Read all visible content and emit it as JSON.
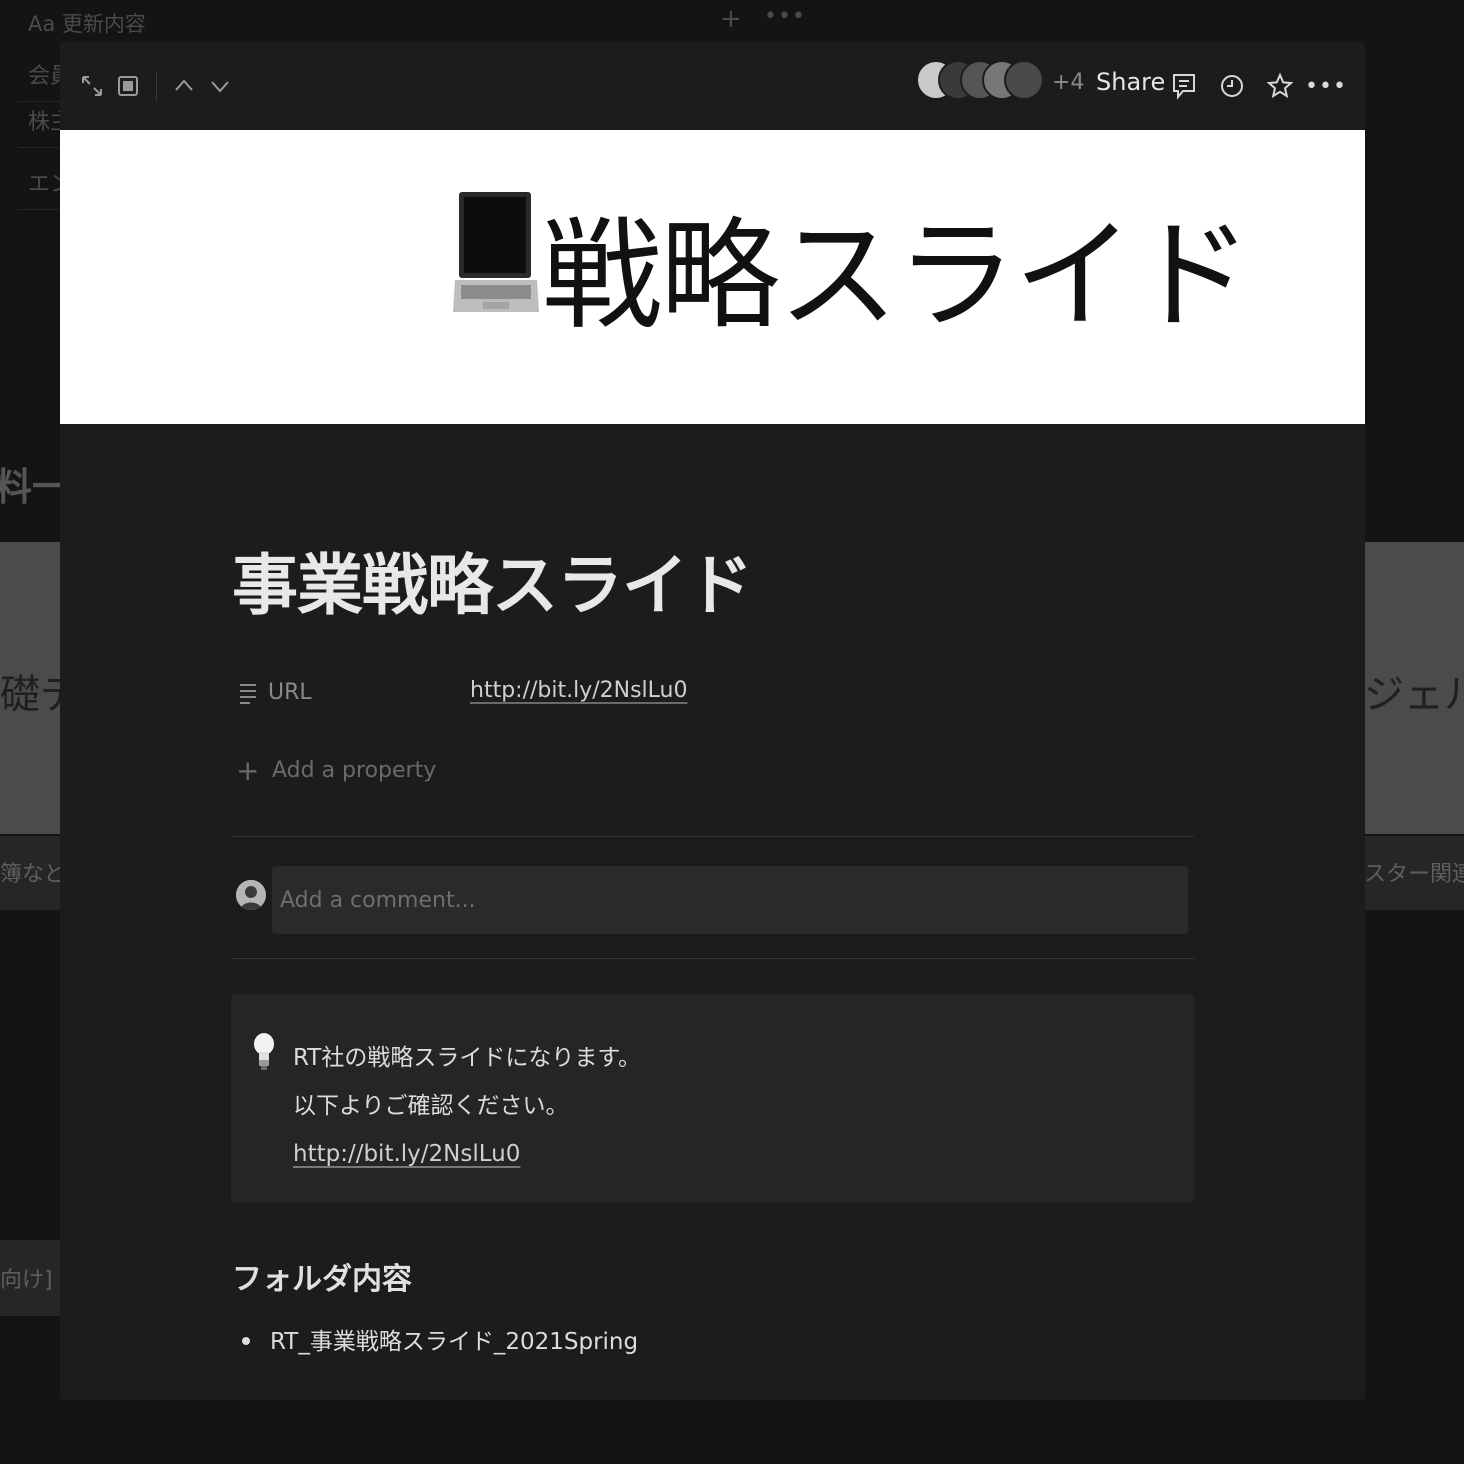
{
  "background": {
    "db_title": "Aa 更新内容",
    "db_plus": "+",
    "db_more": "•••",
    "rows": [
      "会員",
      "株主",
      "エン"
    ],
    "section_heading": "料一式",
    "card_left_title": "礎デ",
    "card_right_title": "ジェル",
    "caption_left": "簿など",
    "caption_right": "スター関連資",
    "caption_left_2": "向け]"
  },
  "topbar": {
    "expand_icon": "expand-icon",
    "peek_icon": "peek-mode-icon",
    "up_icon": "chevron-up-icon",
    "down_icon": "chevron-down-icon",
    "extra_avatars": "+4",
    "share_label": "Share",
    "comments_icon": "comments-icon",
    "updates_icon": "clock-icon",
    "favorite_icon": "star-icon",
    "more_label": "•••"
  },
  "cover": {
    "emoji": "laptop-icon",
    "title": "戦略スライド"
  },
  "page": {
    "title": "事業戦略スライド",
    "properties": [
      {
        "name": "URL",
        "value": "http://bit.ly/2NslLu0"
      }
    ],
    "add_property_label": "Add a property",
    "comment_placeholder": "Add a comment..."
  },
  "callout": {
    "icon": "lightbulb-icon",
    "line1": "RT社の戦略スライドになります。",
    "line2": "以下よりご確認ください。",
    "link": "http://bit.ly/2NslLu0"
  },
  "folder": {
    "heading": "フォルダ内容",
    "items": [
      "RT_事業戦略スライド_2021Spring"
    ]
  },
  "colors": {
    "modal_bg": "#1c1c1c",
    "cover_bg": "#ffffff",
    "callout_bg": "#252525",
    "text_primary": "#e8e8e8",
    "text_muted": "#8a8a8a"
  }
}
